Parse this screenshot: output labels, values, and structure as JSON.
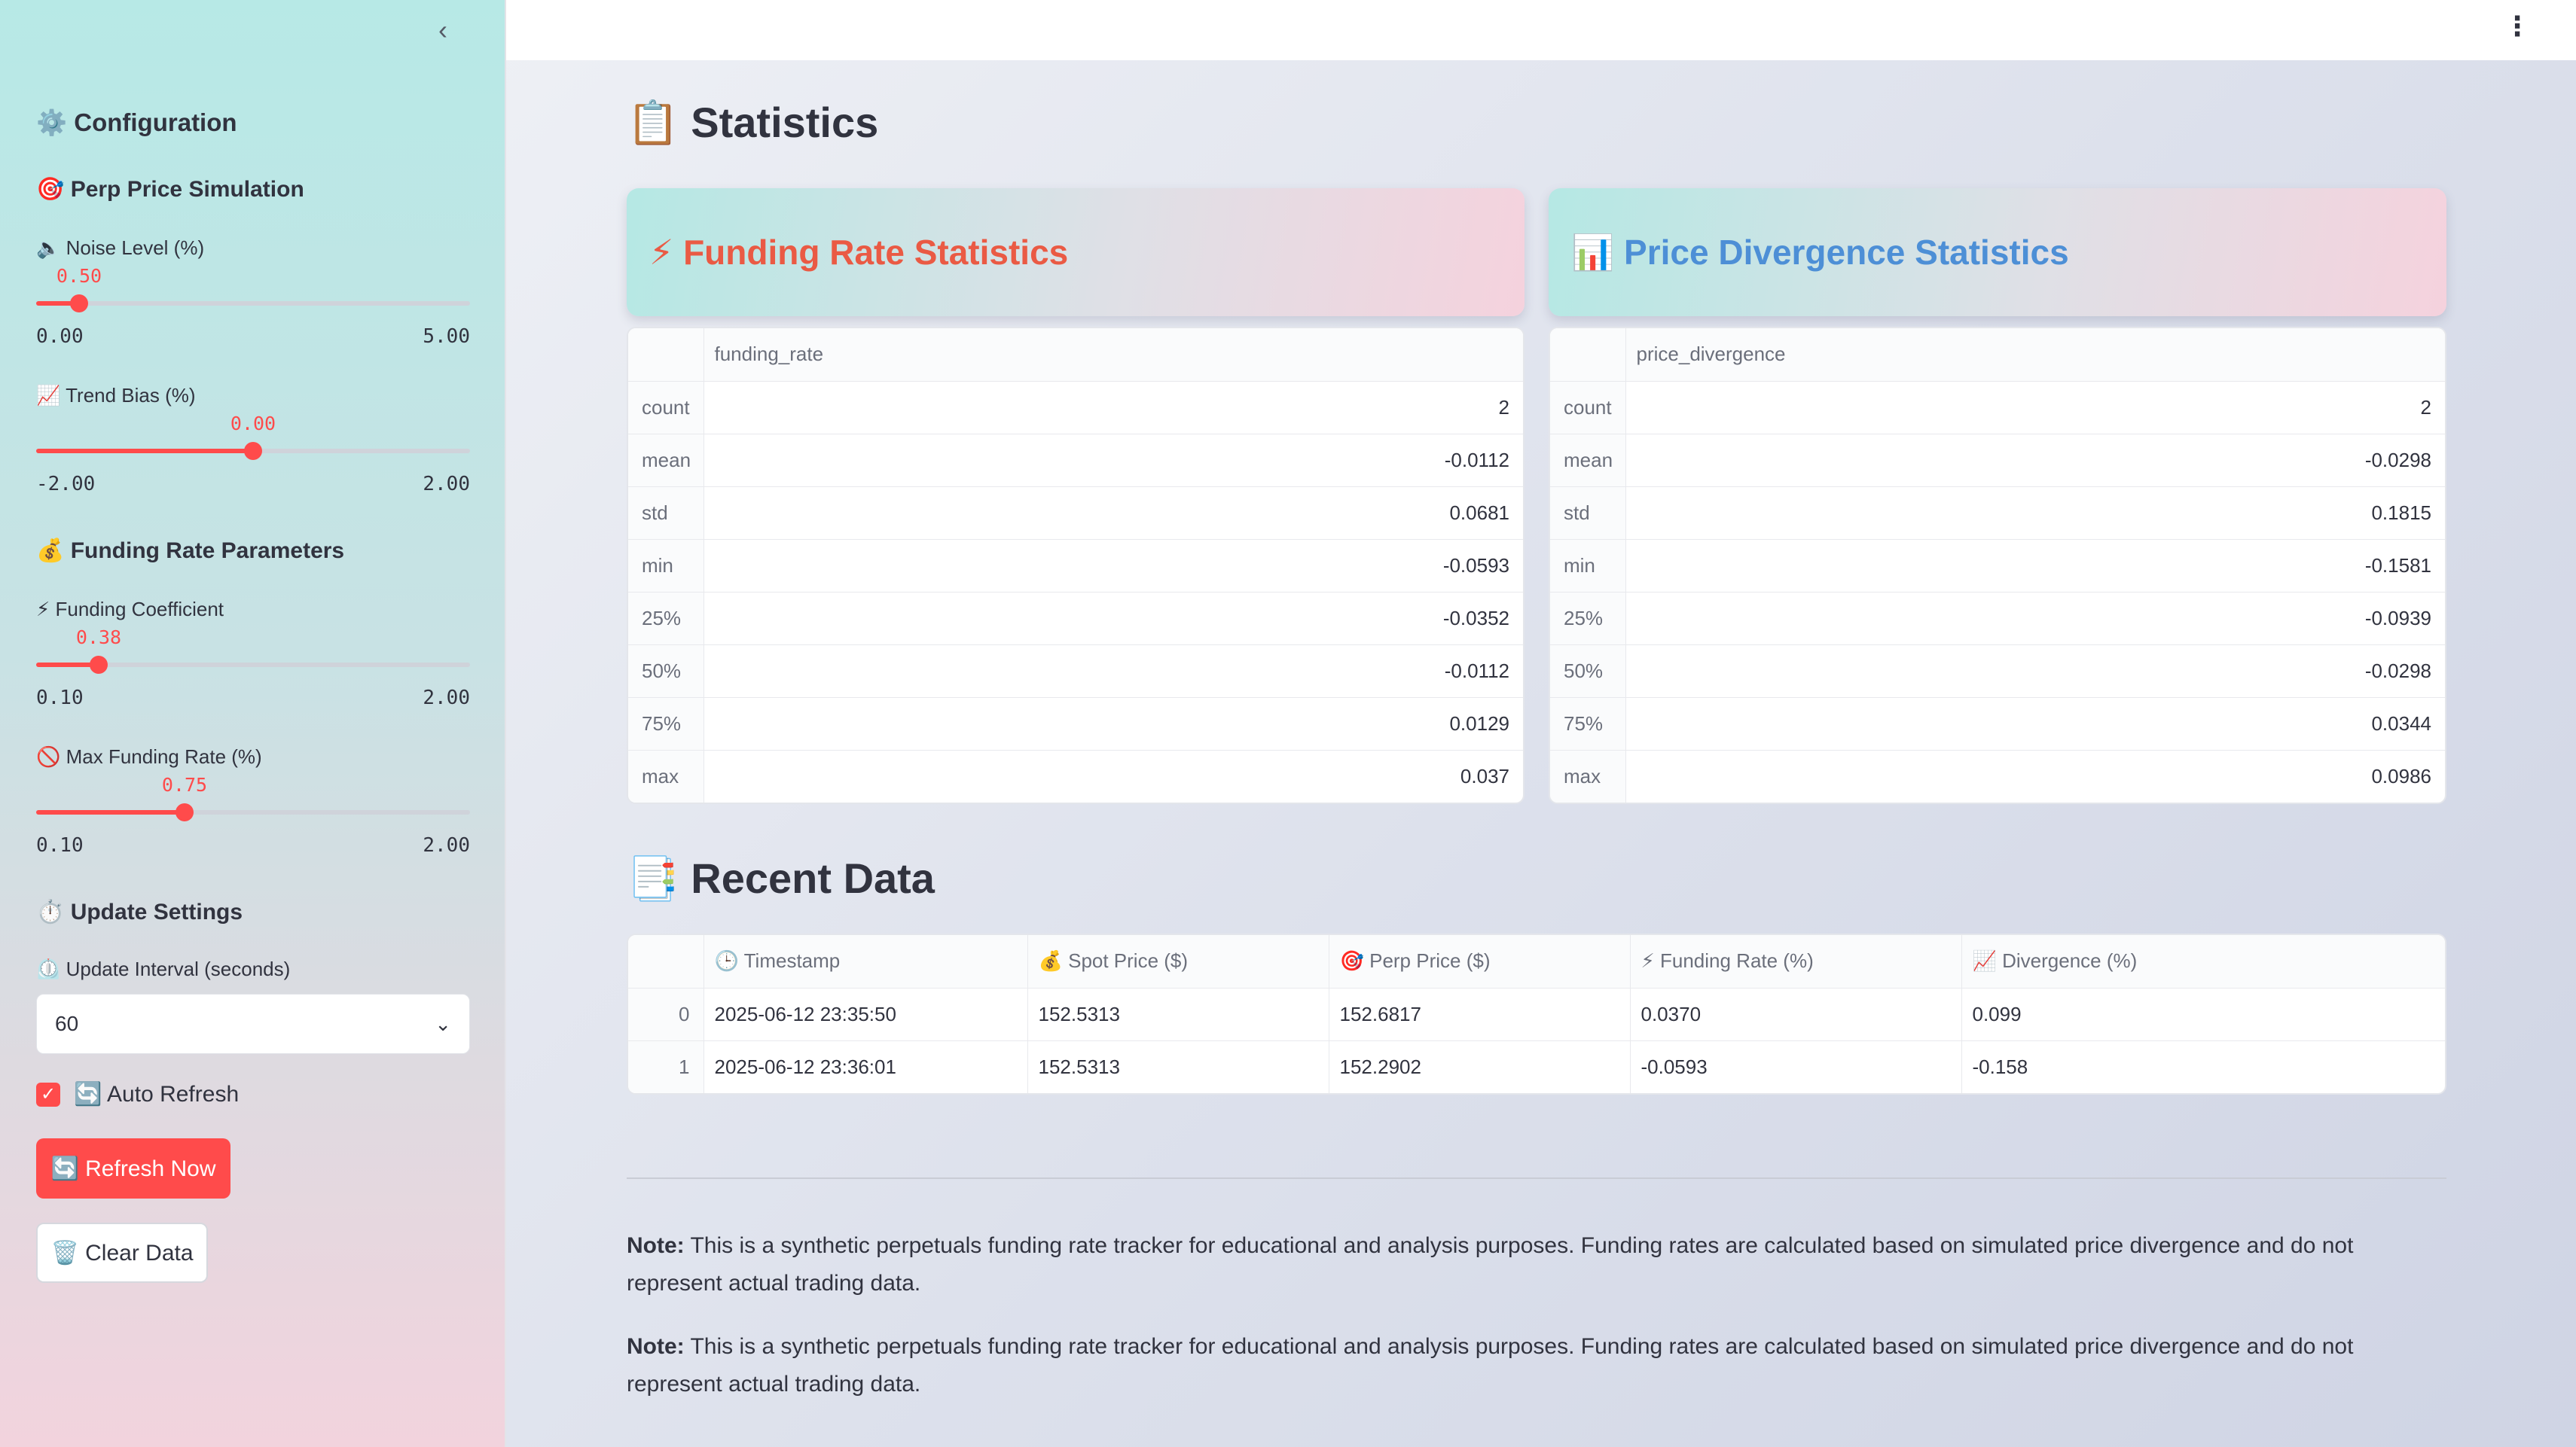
{
  "sidebar": {
    "configuration": "⚙️ Configuration",
    "perp_section": "🎯 Perp Price Simulation",
    "noise": {
      "label": "🔈 Noise Level (%)",
      "value": "0.50",
      "min": "0.00",
      "max": "5.00",
      "fraction": 0.1
    },
    "trend": {
      "label": "📈 Trend Bias (%)",
      "value": "0.00",
      "min": "-2.00",
      "max": "2.00",
      "fraction": 0.5
    },
    "funding_section": "💰 Funding Rate Parameters",
    "coef": {
      "label": "⚡ Funding Coefficient",
      "value": "0.38",
      "min": "0.10",
      "max": "2.00",
      "fraction": 0.147
    },
    "maxrate": {
      "label": "🚫 Max Funding Rate (%)",
      "value": "0.75",
      "min": "0.10",
      "max": "2.00",
      "fraction": 0.342
    },
    "update_section": "⏱️ Update Settings",
    "interval_label": "⏲️ Update Interval (seconds)",
    "interval_value": "60",
    "auto_refresh": "🔄 Auto Refresh",
    "refresh_button": "🔄 Refresh Now",
    "clear_button": "🗑️ Clear Data"
  },
  "main": {
    "statistics_title": "📋 Statistics",
    "funding_card": "⚡ Funding Rate Statistics",
    "divergence_card": "📊 Price Divergence Statistics",
    "funding_stats": {
      "column": "funding_rate",
      "rows": [
        {
          "k": "count",
          "v": "2"
        },
        {
          "k": "mean",
          "v": "-0.0112"
        },
        {
          "k": "std",
          "v": "0.0681"
        },
        {
          "k": "min",
          "v": "-0.0593"
        },
        {
          "k": "25%",
          "v": "-0.0352"
        },
        {
          "k": "50%",
          "v": "-0.0112"
        },
        {
          "k": "75%",
          "v": "0.0129"
        },
        {
          "k": "max",
          "v": "0.037"
        }
      ]
    },
    "divergence_stats": {
      "column": "price_divergence",
      "rows": [
        {
          "k": "count",
          "v": "2"
        },
        {
          "k": "mean",
          "v": "-0.0298"
        },
        {
          "k": "std",
          "v": "0.1815"
        },
        {
          "k": "min",
          "v": "-0.1581"
        },
        {
          "k": "25%",
          "v": "-0.0939"
        },
        {
          "k": "50%",
          "v": "-0.0298"
        },
        {
          "k": "75%",
          "v": "0.0344"
        },
        {
          "k": "max",
          "v": "0.0986"
        }
      ]
    },
    "recent_title": "📑 Recent Data",
    "recent": {
      "headers": [
        "🕒 Timestamp",
        "💰 Spot Price ($)",
        "🎯 Perp Price ($)",
        "⚡ Funding Rate (%)",
        "📈 Divergence (%)"
      ],
      "rows": [
        [
          "0",
          "2025-06-12 23:35:50",
          "152.5313",
          "152.6817",
          "0.0370",
          "0.099"
        ],
        [
          "1",
          "2025-06-12 23:36:01",
          "152.5313",
          "152.2902",
          "-0.0593",
          "-0.158"
        ]
      ]
    },
    "note_label": "Note:",
    "note_text": "This is a synthetic perpetuals funding rate tracker for educational and analysis purposes. Funding rates are calculated based on simulated price divergence and do not represent actual trading data."
  }
}
